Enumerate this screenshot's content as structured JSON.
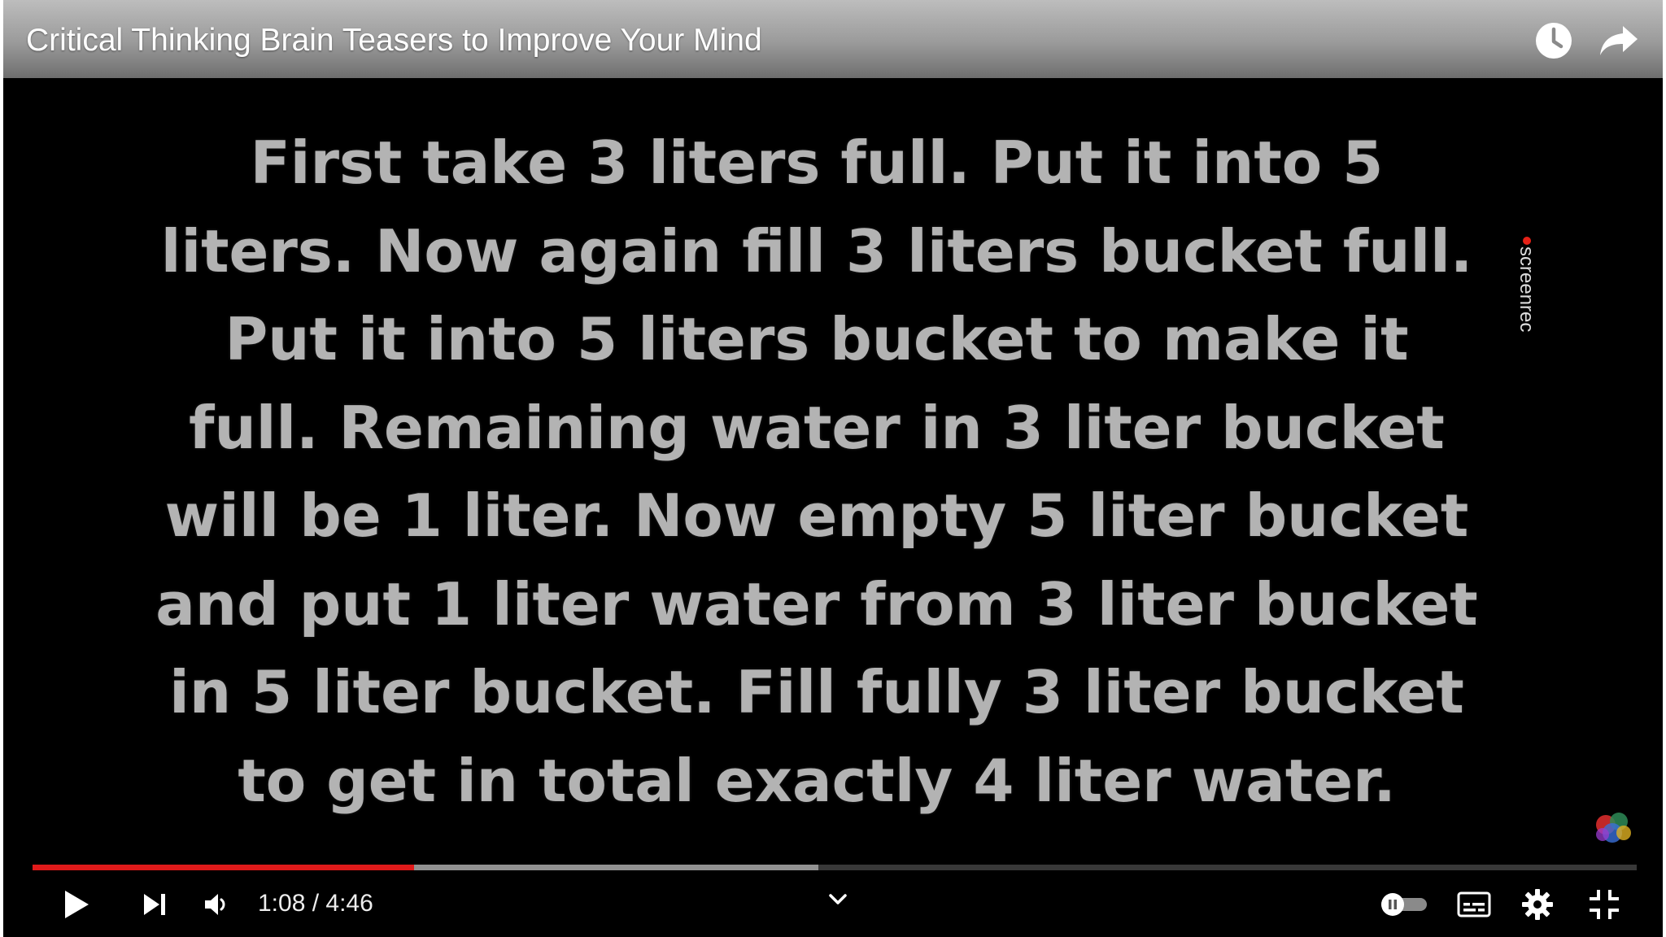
{
  "video": {
    "title": "Critical Thinking Brain Teasers to Improve Your Mind",
    "slide_lines": [
      "First take 3 liters full. Put it into 5",
      "liters. Now again fill 3 liters bucket full.",
      "Put it into 5 liters bucket to make it",
      "full. Remaining water in 3 liter bucket",
      "will be 1 liter. Now empty 5 liter bucket",
      "and put 1 liter water from 3 liter bucket",
      "in 5 liter bucket. Fill fully 3 liter bucket",
      "to get in total exactly 4 liter water."
    ],
    "watermark": "screenrec"
  },
  "player": {
    "current_time": "1:08",
    "duration": "4:46",
    "time_display": "1:08 / 4:46",
    "played_fraction": 0.238,
    "buffered_fraction": 0.49
  },
  "icons": {
    "watch_later": "clock-icon",
    "share": "share-arrow-icon",
    "play": "play-icon",
    "next": "next-icon",
    "volume": "volume-icon",
    "expand": "chevron-down-icon",
    "autoplay": "autoplay-toggle-icon",
    "subtitles": "subtitles-icon",
    "settings": "gear-icon",
    "exit_fullscreen": "exit-fullscreen-icon"
  },
  "colors": {
    "progress_played": "#e01a1a",
    "slide_text": "#b3b3b3",
    "background": "#000000"
  }
}
